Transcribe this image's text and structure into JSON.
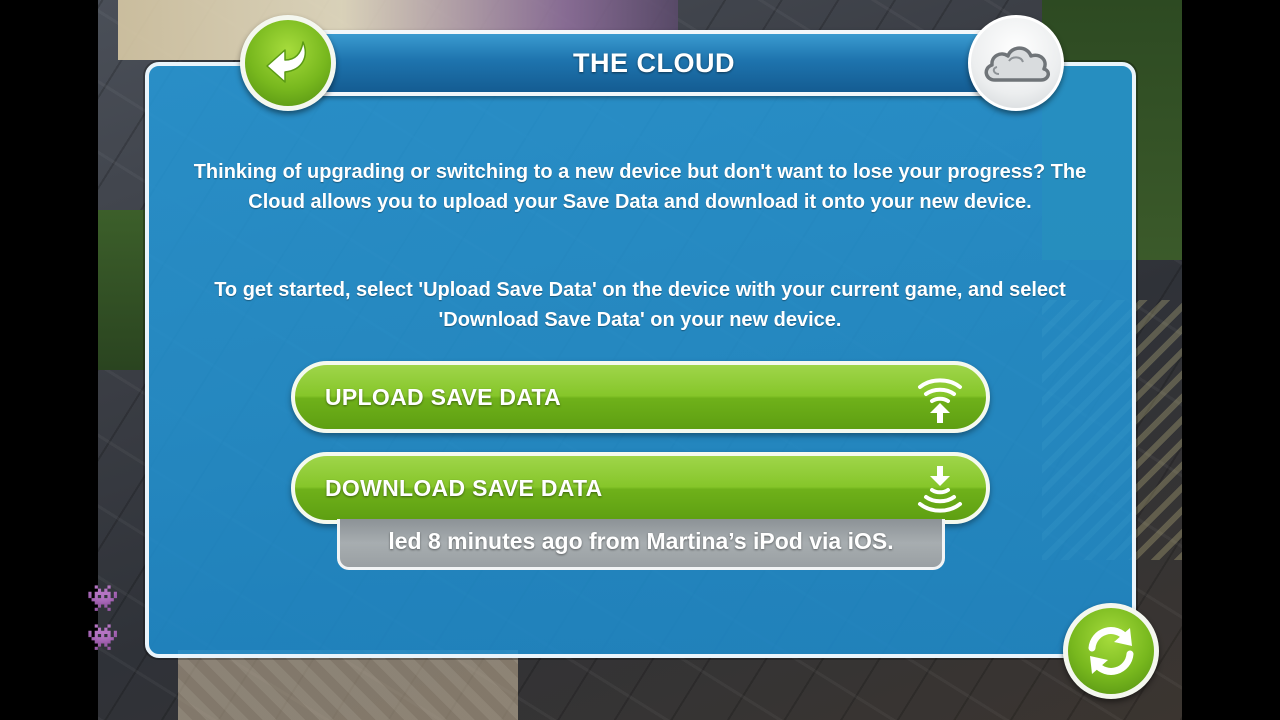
{
  "dialog": {
    "title": "THE CLOUD",
    "paragraph_1": "Thinking of upgrading or switching to a new device but don't want to lose your progress? The Cloud allows you to upload your Save Data and download it onto your new device.",
    "paragraph_2": "To get started, select 'Upload Save Data' on the device with your current game, and select 'Download Save Data' on your new device."
  },
  "buttons": {
    "upload_label": "UPLOAD SAVE DATA",
    "download_label": "DOWNLOAD SAVE DATA"
  },
  "status": {
    "text": "led 8 minutes ago from Martina’s iPod via iOS."
  },
  "icons": {
    "back": "back-arrow-icon",
    "cloud": "cloud-icon",
    "refresh": "refresh-icon",
    "upload": "upload-signal-icon",
    "download": "download-signal-icon",
    "side": "space-invader-icon"
  },
  "colors": {
    "panel_blue": "#2597d6",
    "button_green": "#86c62a",
    "title_blue": "#1e74ae",
    "status_gray": "#a7adb0"
  }
}
